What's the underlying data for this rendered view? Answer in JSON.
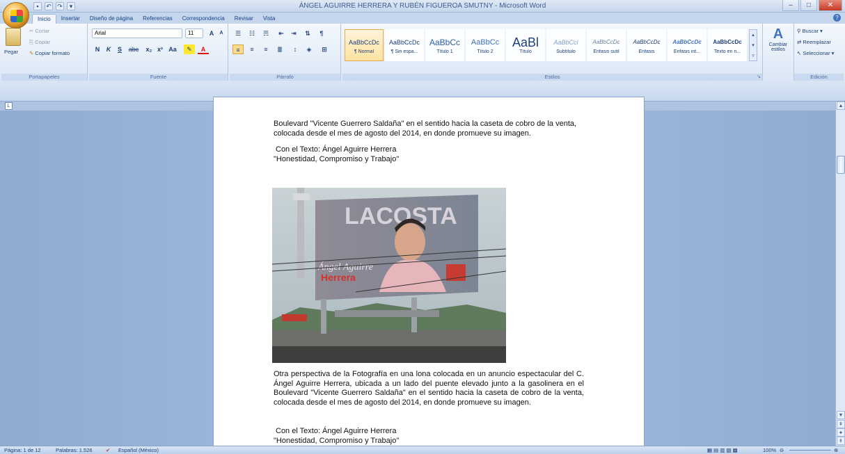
{
  "window": {
    "title": "ÁNGEL AGUIRRE HERRERA Y RUBÉN FIGUEROA SMUTNY - Microsoft Word"
  },
  "tabs": [
    "Inicio",
    "Insertar",
    "Diseño de página",
    "Referencias",
    "Correspondencia",
    "Revisar",
    "Vista"
  ],
  "ribbon": {
    "clipboard": {
      "paste_label": "Pegar",
      "cut_label": "Cortar",
      "copy_label": "Copiar",
      "format_painter_label": "Copiar formato",
      "group_label": "Portapapeles"
    },
    "font": {
      "font_name": "Arial",
      "font_size": "11",
      "group_label": "Fuente"
    },
    "paragraph": {
      "group_label": "Párrafo"
    },
    "styles": {
      "group_label": "Estilos",
      "change_styles_label": "Cambiar estilos",
      "items": [
        {
          "preview": "AaBbCcDc",
          "name": "¶ Normal"
        },
        {
          "preview": "AaBbCcDc",
          "name": "¶ Sin espa..."
        },
        {
          "preview": "AaBbCc",
          "name": "Título 1"
        },
        {
          "preview": "AaBbCc",
          "name": "Título 2"
        },
        {
          "preview": "AaBl",
          "name": "Título"
        },
        {
          "preview": "AaBbCcl",
          "name": "Subtítulo"
        },
        {
          "preview": "AaBbCcDc",
          "name": "Énfasis sutil"
        },
        {
          "preview": "AaBbCcDc",
          "name": "Énfasis"
        },
        {
          "preview": "AaBbCcDc",
          "name": "Énfasis int..."
        },
        {
          "preview": "AaBbCcDc",
          "name": "Texto en n..."
        }
      ]
    },
    "editing": {
      "group_label": "Edición",
      "find_label": "Buscar",
      "replace_label": "Reemplazar",
      "select_label": "Seleccionar"
    }
  },
  "document": {
    "para1": "Boulevard \"Vicente Guerrero Saldaña\" en el sentido hacia la caseta de cobro de la venta, colocada desde el mes de agosto del 2014, en donde promueve su imagen.",
    "text1_line1": "Con el Texto: Ángel Aguirre Herrera",
    "text1_line2": "\"Honestidad, Compromiso y Trabajo\"",
    "para2": "Otra perspectiva de la Fotografía en una lona colocada en un anuncio espectacular del C. Ángel Aguirre Herrera, ubicada a un lado del puente elevado junto a la gasolinera en el Boulevard \"Vicente Guerrero Saldaña\" en el sentido hacia la caseta de cobro de la venta, colocada desde el mes de agosto del 2014, en donde promueve su imagen.",
    "text2_line1": "Con el Texto: Ángel Aguirre Herrera",
    "text2_line2": "\"Honestidad, Compromiso y Trabajo\"",
    "billboard": {
      "brand": "LACOSTA",
      "name_line1": "Ángel Aguirre",
      "name_line2": "Herrera"
    }
  },
  "status": {
    "page": "Página: 1 de 12",
    "words": "Palabras: 1.526",
    "language": "Español (México)",
    "zoom": "100%"
  }
}
